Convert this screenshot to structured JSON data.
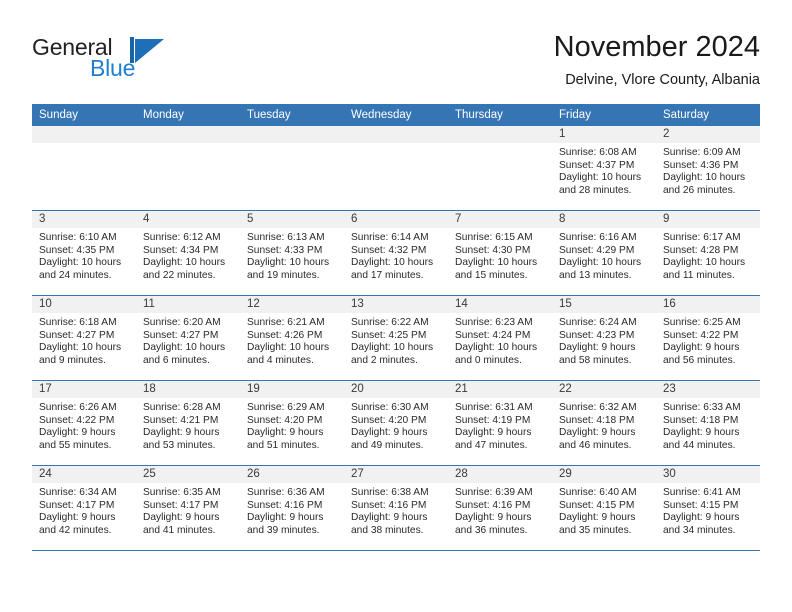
{
  "brand": {
    "name_part1": "General",
    "name_part2": "Blue"
  },
  "header": {
    "month_title": "November 2024",
    "location": "Delvine, Vlore County, Albania"
  },
  "colors": {
    "header_blue": "#3575b4",
    "brand_blue": "#1f7fd0",
    "date_band": "#f1f1f1",
    "text": "#1a1a1a"
  },
  "calendar": {
    "weekday_headers": [
      "Sunday",
      "Monday",
      "Tuesday",
      "Wednesday",
      "Thursday",
      "Friday",
      "Saturday"
    ],
    "labels": {
      "sunrise_prefix": "Sunrise: ",
      "sunset_prefix": "Sunset: ",
      "daylight_prefix": "Daylight: "
    },
    "weeks": [
      [
        {
          "day": "",
          "empty": true
        },
        {
          "day": "",
          "empty": true
        },
        {
          "day": "",
          "empty": true
        },
        {
          "day": "",
          "empty": true
        },
        {
          "day": "",
          "empty": true
        },
        {
          "day": "1",
          "sunrise": "Sunrise: 6:08 AM",
          "sunset": "Sunset: 4:37 PM",
          "daylight_line1": "Daylight: 10 hours",
          "daylight_line2": "and 28 minutes."
        },
        {
          "day": "2",
          "sunrise": "Sunrise: 6:09 AM",
          "sunset": "Sunset: 4:36 PM",
          "daylight_line1": "Daylight: 10 hours",
          "daylight_line2": "and 26 minutes."
        }
      ],
      [
        {
          "day": "3",
          "sunrise": "Sunrise: 6:10 AM",
          "sunset": "Sunset: 4:35 PM",
          "daylight_line1": "Daylight: 10 hours",
          "daylight_line2": "and 24 minutes."
        },
        {
          "day": "4",
          "sunrise": "Sunrise: 6:12 AM",
          "sunset": "Sunset: 4:34 PM",
          "daylight_line1": "Daylight: 10 hours",
          "daylight_line2": "and 22 minutes."
        },
        {
          "day": "5",
          "sunrise": "Sunrise: 6:13 AM",
          "sunset": "Sunset: 4:33 PM",
          "daylight_line1": "Daylight: 10 hours",
          "daylight_line2": "and 19 minutes."
        },
        {
          "day": "6",
          "sunrise": "Sunrise: 6:14 AM",
          "sunset": "Sunset: 4:32 PM",
          "daylight_line1": "Daylight: 10 hours",
          "daylight_line2": "and 17 minutes."
        },
        {
          "day": "7",
          "sunrise": "Sunrise: 6:15 AM",
          "sunset": "Sunset: 4:30 PM",
          "daylight_line1": "Daylight: 10 hours",
          "daylight_line2": "and 15 minutes."
        },
        {
          "day": "8",
          "sunrise": "Sunrise: 6:16 AM",
          "sunset": "Sunset: 4:29 PM",
          "daylight_line1": "Daylight: 10 hours",
          "daylight_line2": "and 13 minutes."
        },
        {
          "day": "9",
          "sunrise": "Sunrise: 6:17 AM",
          "sunset": "Sunset: 4:28 PM",
          "daylight_line1": "Daylight: 10 hours",
          "daylight_line2": "and 11 minutes."
        }
      ],
      [
        {
          "day": "10",
          "sunrise": "Sunrise: 6:18 AM",
          "sunset": "Sunset: 4:27 PM",
          "daylight_line1": "Daylight: 10 hours",
          "daylight_line2": "and 9 minutes."
        },
        {
          "day": "11",
          "sunrise": "Sunrise: 6:20 AM",
          "sunset": "Sunset: 4:27 PM",
          "daylight_line1": "Daylight: 10 hours",
          "daylight_line2": "and 6 minutes."
        },
        {
          "day": "12",
          "sunrise": "Sunrise: 6:21 AM",
          "sunset": "Sunset: 4:26 PM",
          "daylight_line1": "Daylight: 10 hours",
          "daylight_line2": "and 4 minutes."
        },
        {
          "day": "13",
          "sunrise": "Sunrise: 6:22 AM",
          "sunset": "Sunset: 4:25 PM",
          "daylight_line1": "Daylight: 10 hours",
          "daylight_line2": "and 2 minutes."
        },
        {
          "day": "14",
          "sunrise": "Sunrise: 6:23 AM",
          "sunset": "Sunset: 4:24 PM",
          "daylight_line1": "Daylight: 10 hours",
          "daylight_line2": "and 0 minutes."
        },
        {
          "day": "15",
          "sunrise": "Sunrise: 6:24 AM",
          "sunset": "Sunset: 4:23 PM",
          "daylight_line1": "Daylight: 9 hours",
          "daylight_line2": "and 58 minutes."
        },
        {
          "day": "16",
          "sunrise": "Sunrise: 6:25 AM",
          "sunset": "Sunset: 4:22 PM",
          "daylight_line1": "Daylight: 9 hours",
          "daylight_line2": "and 56 minutes."
        }
      ],
      [
        {
          "day": "17",
          "sunrise": "Sunrise: 6:26 AM",
          "sunset": "Sunset: 4:22 PM",
          "daylight_line1": "Daylight: 9 hours",
          "daylight_line2": "and 55 minutes."
        },
        {
          "day": "18",
          "sunrise": "Sunrise: 6:28 AM",
          "sunset": "Sunset: 4:21 PM",
          "daylight_line1": "Daylight: 9 hours",
          "daylight_line2": "and 53 minutes."
        },
        {
          "day": "19",
          "sunrise": "Sunrise: 6:29 AM",
          "sunset": "Sunset: 4:20 PM",
          "daylight_line1": "Daylight: 9 hours",
          "daylight_line2": "and 51 minutes."
        },
        {
          "day": "20",
          "sunrise": "Sunrise: 6:30 AM",
          "sunset": "Sunset: 4:20 PM",
          "daylight_line1": "Daylight: 9 hours",
          "daylight_line2": "and 49 minutes."
        },
        {
          "day": "21",
          "sunrise": "Sunrise: 6:31 AM",
          "sunset": "Sunset: 4:19 PM",
          "daylight_line1": "Daylight: 9 hours",
          "daylight_line2": "and 47 minutes."
        },
        {
          "day": "22",
          "sunrise": "Sunrise: 6:32 AM",
          "sunset": "Sunset: 4:18 PM",
          "daylight_line1": "Daylight: 9 hours",
          "daylight_line2": "and 46 minutes."
        },
        {
          "day": "23",
          "sunrise": "Sunrise: 6:33 AM",
          "sunset": "Sunset: 4:18 PM",
          "daylight_line1": "Daylight: 9 hours",
          "daylight_line2": "and 44 minutes."
        }
      ],
      [
        {
          "day": "24",
          "sunrise": "Sunrise: 6:34 AM",
          "sunset": "Sunset: 4:17 PM",
          "daylight_line1": "Daylight: 9 hours",
          "daylight_line2": "and 42 minutes."
        },
        {
          "day": "25",
          "sunrise": "Sunrise: 6:35 AM",
          "sunset": "Sunset: 4:17 PM",
          "daylight_line1": "Daylight: 9 hours",
          "daylight_line2": "and 41 minutes."
        },
        {
          "day": "26",
          "sunrise": "Sunrise: 6:36 AM",
          "sunset": "Sunset: 4:16 PM",
          "daylight_line1": "Daylight: 9 hours",
          "daylight_line2": "and 39 minutes."
        },
        {
          "day": "27",
          "sunrise": "Sunrise: 6:38 AM",
          "sunset": "Sunset: 4:16 PM",
          "daylight_line1": "Daylight: 9 hours",
          "daylight_line2": "and 38 minutes."
        },
        {
          "day": "28",
          "sunrise": "Sunrise: 6:39 AM",
          "sunset": "Sunset: 4:16 PM",
          "daylight_line1": "Daylight: 9 hours",
          "daylight_line2": "and 36 minutes."
        },
        {
          "day": "29",
          "sunrise": "Sunrise: 6:40 AM",
          "sunset": "Sunset: 4:15 PM",
          "daylight_line1": "Daylight: 9 hours",
          "daylight_line2": "and 35 minutes."
        },
        {
          "day": "30",
          "sunrise": "Sunrise: 6:41 AM",
          "sunset": "Sunset: 4:15 PM",
          "daylight_line1": "Daylight: 9 hours",
          "daylight_line2": "and 34 minutes."
        }
      ]
    ]
  }
}
